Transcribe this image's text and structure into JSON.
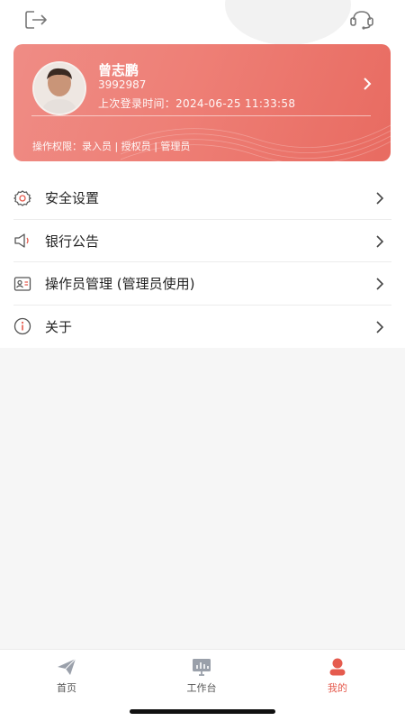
{
  "header": {
    "logout_icon": "logout-icon",
    "service_icon": "customer-service-icon"
  },
  "profile": {
    "name": "曾志鹏",
    "id": "3992987",
    "last_login": "上次登录时间：2024-06-25 11:33:58",
    "permissions": "操作权限：录入员 | 授权员 | 管理员",
    "colors": {
      "card_start": "#ef8c85",
      "card_end": "#e86b61"
    }
  },
  "menu": {
    "items": [
      {
        "label": "安全设置",
        "icon": "gear-icon"
      },
      {
        "label": "银行公告",
        "icon": "speaker-icon"
      },
      {
        "label": "操作员管理 (管理员使用)",
        "icon": "id-card-icon"
      },
      {
        "label": "关于",
        "icon": "info-icon"
      }
    ]
  },
  "tabbar": {
    "tabs": [
      {
        "label": "首页",
        "icon": "paper-plane-icon"
      },
      {
        "label": "工作台",
        "icon": "monitor-chart-icon"
      },
      {
        "label": "我的",
        "icon": "user-icon",
        "active": true
      }
    ],
    "colors": {
      "active": "#e55b4e",
      "inactive": "#9aa0aa"
    }
  }
}
